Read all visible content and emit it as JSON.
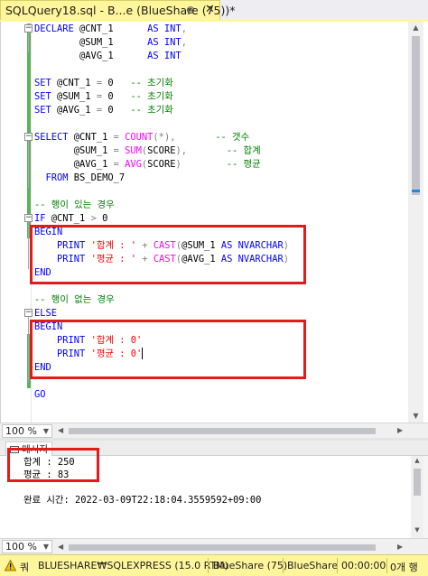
{
  "tab": {
    "title": "SQLQuery18.sql - B...e (BlueShare (75))*",
    "pin": "⊕",
    "close": "✕"
  },
  "editor": {
    "lines": [
      [
        {
          "t": "DECLARE ",
          "c": "kw"
        },
        {
          "t": "@CNT_1      "
        },
        {
          "t": "AS ",
          "c": "kw"
        },
        {
          "t": "INT",
          "c": "kw"
        },
        {
          "t": ",",
          "c": "op"
        }
      ],
      [
        {
          "t": "        @SUM_1      "
        },
        {
          "t": "AS ",
          "c": "kw"
        },
        {
          "t": "INT",
          "c": "kw"
        },
        {
          "t": ",",
          "c": "op"
        }
      ],
      [
        {
          "t": "        @AVG_1      "
        },
        {
          "t": "AS ",
          "c": "kw"
        },
        {
          "t": "INT",
          "c": "kw"
        }
      ],
      [],
      [
        {
          "t": "SET ",
          "c": "kw"
        },
        {
          "t": "@CNT_1 "
        },
        {
          "t": "=",
          "c": "op"
        },
        {
          "t": " 0   "
        },
        {
          "t": "-- 초기화",
          "c": "cmt"
        }
      ],
      [
        {
          "t": "SET ",
          "c": "kw"
        },
        {
          "t": "@SUM_1 "
        },
        {
          "t": "=",
          "c": "op"
        },
        {
          "t": " 0   "
        },
        {
          "t": "-- 초기화",
          "c": "cmt"
        }
      ],
      [
        {
          "t": "SET ",
          "c": "kw"
        },
        {
          "t": "@AVG_1 "
        },
        {
          "t": "=",
          "c": "op"
        },
        {
          "t": " 0   "
        },
        {
          "t": "-- 초기화",
          "c": "cmt"
        }
      ],
      [],
      [
        {
          "t": "SELECT ",
          "c": "kw"
        },
        {
          "t": "@CNT_1 "
        },
        {
          "t": "=",
          "c": "op"
        },
        {
          "t": " "
        },
        {
          "t": "COUNT",
          "c": "fn"
        },
        {
          "t": "(",
          "c": "op"
        },
        {
          "t": "*",
          "c": "op"
        },
        {
          "t": "),",
          "c": "op"
        },
        {
          "t": "       "
        },
        {
          "t": "-- 갯수",
          "c": "cmt"
        }
      ],
      [
        {
          "t": "       @SUM_1 "
        },
        {
          "t": "=",
          "c": "op"
        },
        {
          "t": " "
        },
        {
          "t": "SUM",
          "c": "fn"
        },
        {
          "t": "(",
          "c": "op"
        },
        {
          "t": "SCORE"
        },
        {
          "t": "),",
          "c": "op"
        },
        {
          "t": "       "
        },
        {
          "t": "-- 합계",
          "c": "cmt"
        }
      ],
      [
        {
          "t": "       @AVG_1 "
        },
        {
          "t": "=",
          "c": "op"
        },
        {
          "t": " "
        },
        {
          "t": "AVG",
          "c": "fn"
        },
        {
          "t": "(",
          "c": "op"
        },
        {
          "t": "SCORE"
        },
        {
          "t": ")",
          "c": "op"
        },
        {
          "t": "        "
        },
        {
          "t": "-- 평균",
          "c": "cmt"
        }
      ],
      [
        {
          "t": "  FROM ",
          "c": "kw"
        },
        {
          "t": "BS_DEMO_7"
        }
      ],
      [],
      [
        {
          "t": "-- 행이 있는 경우",
          "c": "cmt"
        }
      ],
      [
        {
          "t": "IF ",
          "c": "kw"
        },
        {
          "t": "@CNT_1 "
        },
        {
          "t": ">",
          "c": "op"
        },
        {
          "t": " 0"
        }
      ],
      [
        {
          "t": "BEGIN",
          "c": "kw"
        }
      ],
      [
        {
          "t": "    "
        },
        {
          "t": "PRINT ",
          "c": "kw"
        },
        {
          "t": "'합계 : '",
          "c": "str"
        },
        {
          "t": " "
        },
        {
          "t": "+",
          "c": "op"
        },
        {
          "t": " "
        },
        {
          "t": "CAST",
          "c": "fn"
        },
        {
          "t": "(",
          "c": "op"
        },
        {
          "t": "@SUM_1 "
        },
        {
          "t": "AS ",
          "c": "kw"
        },
        {
          "t": "NVARCHAR",
          "c": "kw"
        },
        {
          "t": ")",
          "c": "op"
        }
      ],
      [
        {
          "t": "    "
        },
        {
          "t": "PRINT ",
          "c": "kw"
        },
        {
          "t": "'평균 : '",
          "c": "str"
        },
        {
          "t": " "
        },
        {
          "t": "+",
          "c": "op"
        },
        {
          "t": " "
        },
        {
          "t": "CAST",
          "c": "fn"
        },
        {
          "t": "(",
          "c": "op"
        },
        {
          "t": "@AVG_1 "
        },
        {
          "t": "AS ",
          "c": "kw"
        },
        {
          "t": "NVARCHAR",
          "c": "kw"
        },
        {
          "t": ")",
          "c": "op"
        }
      ],
      [
        {
          "t": "END",
          "c": "kw"
        }
      ],
      [],
      [
        {
          "t": "-- 행이 없는 경우",
          "c": "cmt"
        }
      ],
      [
        {
          "t": "ELSE",
          "c": "kw"
        }
      ],
      [
        {
          "t": "BEGIN",
          "c": "kw"
        }
      ],
      [
        {
          "t": "    "
        },
        {
          "t": "PRINT ",
          "c": "kw"
        },
        {
          "t": "'합계 : 0'",
          "c": "str"
        }
      ],
      [
        {
          "t": "    "
        },
        {
          "t": "PRINT ",
          "c": "kw"
        },
        {
          "t": "'평균 : 0'",
          "c": "str"
        },
        {
          "caret": true
        }
      ],
      [
        {
          "t": "END",
          "c": "kw"
        }
      ],
      [],
      [
        {
          "t": "GO",
          "c": "kw"
        }
      ]
    ],
    "zoom": "100 %"
  },
  "results": {
    "tab_label": "메시지",
    "lines": [
      "합계 : 250",
      "평균 : 83",
      "",
      "완료 시간: 2022-03-09T22:18:04.3559592+09:00"
    ],
    "zoom": "100 %"
  },
  "status": {
    "message": "쿼",
    "server": "BLUESHARE₩SQLEXPRESS (15.0 RTM)",
    "database_user": "BlueShare (75)",
    "database": "BlueShare",
    "elapsed": "00:00:00",
    "rows": "0개 행"
  },
  "colors": {
    "keyword": "#0000ff",
    "function": "#ff00ff",
    "string": "#ff0000",
    "comment": "#008000",
    "highlight_box": "#e21b1b",
    "tab_active": "#fff59a"
  }
}
